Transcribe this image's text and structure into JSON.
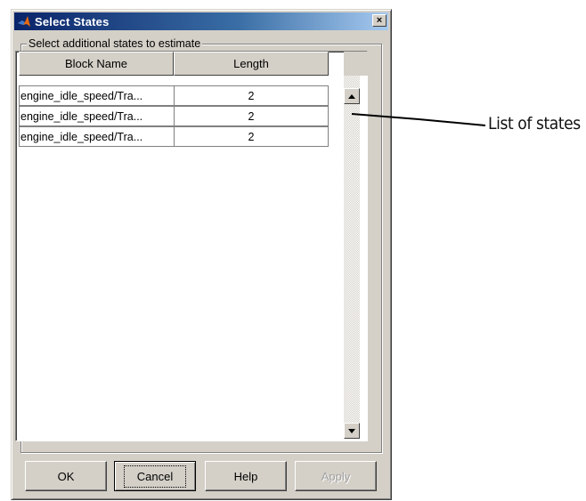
{
  "window": {
    "title": "Select States",
    "close_glyph": "×"
  },
  "group": {
    "legend": "Select additional states to estimate"
  },
  "table": {
    "columns": [
      "Block Name",
      "Length"
    ],
    "rows": [
      {
        "block": "engine_idle_speed/Tra...",
        "length": "2"
      },
      {
        "block": "engine_idle_speed/Tra...",
        "length": "2"
      },
      {
        "block": "engine_idle_speed/Tra...",
        "length": "2"
      }
    ]
  },
  "buttons": {
    "ok": "OK",
    "cancel": "Cancel",
    "help": "Help",
    "apply": "Apply"
  },
  "annotation": {
    "label": "List of states"
  },
  "icons": {
    "app": "matlab-icon",
    "close": "close-icon",
    "scroll_up": "arrow-up-icon",
    "scroll_down": "arrow-down-icon"
  },
  "colors": {
    "title_bar_start": "#0a246a",
    "title_bar_end": "#a6caf0",
    "dialog_face": "#d4d0c8"
  }
}
